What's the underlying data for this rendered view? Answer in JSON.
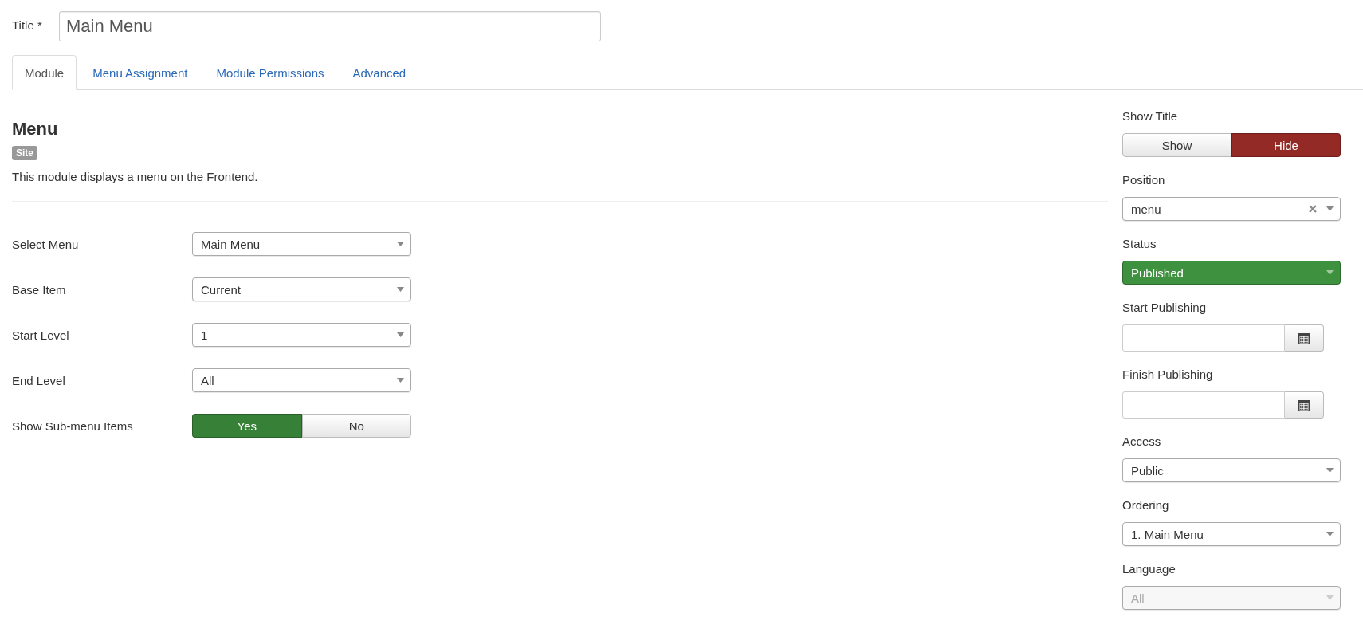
{
  "title_field": {
    "label": "Title *",
    "value": "Main Menu"
  },
  "tabs": [
    {
      "label": "Module",
      "selected": true
    },
    {
      "label": "Menu Assignment",
      "selected": false
    },
    {
      "label": "Module Permissions",
      "selected": false
    },
    {
      "label": "Advanced",
      "selected": false
    }
  ],
  "module": {
    "heading": "Menu",
    "badge": "Site",
    "description": "This module displays a menu on the Frontend."
  },
  "basic_fields": [
    {
      "kind": "select",
      "label": "Select Menu",
      "value": "Main Menu"
    },
    {
      "kind": "select",
      "label": "Base Item",
      "value": "Current"
    },
    {
      "kind": "select",
      "label": "Start Level",
      "value": "1"
    },
    {
      "kind": "select",
      "label": "End Level",
      "value": "All"
    },
    {
      "kind": "toggle",
      "label": "Show Sub-menu Items",
      "color": "#378037",
      "options": [
        {
          "label": "Yes",
          "selected": true
        },
        {
          "label": "No",
          "selected": false
        }
      ]
    }
  ],
  "side_fields": [
    {
      "kind": "toggle",
      "label": "Show Title",
      "color": "#942a25",
      "options": [
        {
          "label": "Show",
          "selected": false
        },
        {
          "label": "Hide",
          "selected": true
        }
      ]
    },
    {
      "kind": "select",
      "label": "Position",
      "value": "menu",
      "clearable": true
    },
    {
      "kind": "select",
      "label": "Status",
      "value": "Published",
      "color": "#3e913e"
    },
    {
      "kind": "date",
      "label": "Start Publishing"
    },
    {
      "kind": "date",
      "label": "Finish Publishing"
    },
    {
      "kind": "select",
      "label": "Access",
      "value": "Public"
    },
    {
      "kind": "select",
      "label": "Ordering",
      "value": "1. Main Menu"
    },
    {
      "kind": "select",
      "label": "Language",
      "value": "All",
      "disabled": true
    }
  ]
}
